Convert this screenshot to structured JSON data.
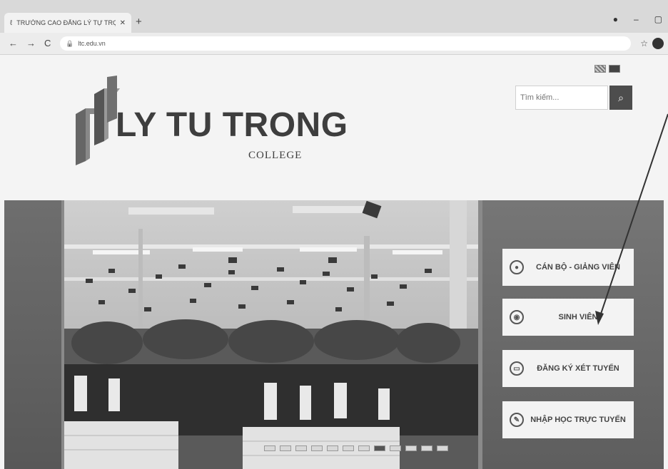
{
  "browser": {
    "tab_title": "TRƯỜNG CAO ĐẲNG LÝ TỰ TRỌ",
    "new_tab_symbol": "+",
    "url": "ltc.edu.vn",
    "window_controls": [
      "●",
      "–",
      "▢"
    ]
  },
  "header": {
    "logo_name": "LY TU TRONG",
    "logo_sub": "COLLEGE",
    "search_placeholder": "Tìm kiếm...",
    "search_icon": "magnifier-icon",
    "languages": [
      "uk-flag",
      "vn-flag"
    ]
  },
  "banner": {
    "slide_count": 12,
    "active_slide": 7,
    "menu": [
      {
        "label": "CÁN BỘ - GIẢNG VIÊN",
        "icon": "person-icon"
      },
      {
        "label": "SINH VIÊN",
        "icon": "student-icon"
      },
      {
        "label": "ĐĂNG KÝ XÉT TUYỂN",
        "icon": "register-icon"
      },
      {
        "label": "NHẬP HỌC TRỰC TUYẾN",
        "icon": "enroll-icon"
      }
    ]
  },
  "colors": {
    "panel": "#6a6a6a",
    "button_bg": "#f3f3f3",
    "search_button": "#4d4d4d",
    "logo_text": "#3e3e3e"
  }
}
